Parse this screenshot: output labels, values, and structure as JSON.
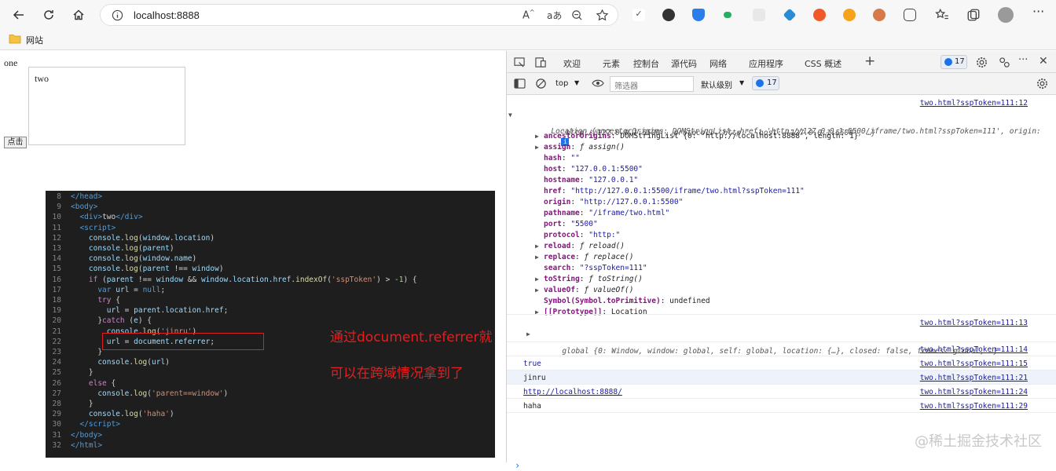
{
  "browser": {
    "url": "localhost:8888",
    "bookmark_label": "网站"
  },
  "page": {
    "outer_text": "one",
    "iframe_text": "two",
    "button_label": "点击"
  },
  "code_lines": [
    {
      "n": "8",
      "html": "<span class=\"t\">&lt;/head&gt;</span>"
    },
    {
      "n": "9",
      "html": "<span class=\"t\">&lt;body&gt;</span>"
    },
    {
      "n": "10",
      "html": "  <span class=\"t\">&lt;div&gt;</span>two<span class=\"t\">&lt;/div&gt;</span>"
    },
    {
      "n": "11",
      "html": "  <span class=\"t\">&lt;script&gt;</span>"
    },
    {
      "n": "12",
      "html": "    <span class=\"v\">console</span>.<span class=\"f\">log</span>(<span class=\"v\">window</span>.<span class=\"v\">location</span>)"
    },
    {
      "n": "13",
      "html": "    <span class=\"v\">console</span>.<span class=\"f\">log</span>(<span class=\"v\">parent</span>)"
    },
    {
      "n": "14",
      "html": "    <span class=\"v\">console</span>.<span class=\"f\">log</span>(<span class=\"v\">window</span>.<span class=\"v\">name</span>)"
    },
    {
      "n": "15",
      "html": "    <span class=\"v\">console</span>.<span class=\"f\">log</span>(<span class=\"v\">parent</span> !== <span class=\"v\">window</span>)"
    },
    {
      "n": "16",
      "html": "    <span class=\"k\">if</span> (<span class=\"v\">parent</span> !== <span class=\"v\">window</span> &amp;&amp; <span class=\"v\">window</span>.<span class=\"v\">location</span>.<span class=\"v\">href</span>.<span class=\"f\">indexOf</span>(<span class=\"s\">'sspToken'</span>) &gt; <span class=\"n\">-1</span>) {"
    },
    {
      "n": "17",
      "html": "      <span class=\"t\">var</span> <span class=\"v\">url</span> = <span class=\"t\">null</span>;"
    },
    {
      "n": "18",
      "html": "      <span class=\"k\">try</span> {"
    },
    {
      "n": "19",
      "html": "        <span class=\"v\">url</span> = <span class=\"v\">parent</span>.<span class=\"v\">location</span>.<span class=\"v\">href</span>;"
    },
    {
      "n": "20",
      "html": "      }<span class=\"k\">catch</span> (<span class=\"v\">e</span>) {"
    },
    {
      "n": "21",
      "html": "        <span class=\"v\">console</span>.<span class=\"f\">log</span>(<span class=\"s\">'jinru'</span>)"
    },
    {
      "n": "22",
      "html": "        <span class=\"v\">url</span> = <span class=\"v\">document</span>.<span class=\"v\">referrer</span>;"
    },
    {
      "n": "23",
      "html": "      }"
    },
    {
      "n": "24",
      "html": "      <span class=\"v\">console</span>.<span class=\"f\">log</span>(<span class=\"v\">url</span>)"
    },
    {
      "n": "25",
      "html": "    }"
    },
    {
      "n": "26",
      "html": "    <span class=\"k\">else</span> {"
    },
    {
      "n": "27",
      "html": "      <span class=\"v\">console</span>.<span class=\"f\">log</span>(<span class=\"s\">'parent==window'</span>)"
    },
    {
      "n": "28",
      "html": "    }"
    },
    {
      "n": "29",
      "html": "    <span class=\"v\">console</span>.<span class=\"f\">log</span>(<span class=\"s\">'haha'</span>)"
    },
    {
      "n": "30",
      "html": "  <span class=\"t\">&lt;/script&gt;</span>"
    },
    {
      "n": "31",
      "html": "<span class=\"t\">&lt;/body&gt;</span>"
    },
    {
      "n": "32",
      "html": "<span class=\"t\">&lt;/html&gt;</span>"
    }
  ],
  "annotation": {
    "line1": "通过document.referrer就",
    "line2": "可以在跨域情况拿到了"
  },
  "devtools": {
    "tabs": [
      "欢迎",
      "元素",
      "控制台",
      "源代码",
      "网络",
      "应用程序",
      "CSS 概述"
    ],
    "active_tab": "控制台",
    "issues_count": "17",
    "context": "top",
    "filter_placeholder": "筛选器",
    "level": "默认级别",
    "level_count": "17"
  },
  "console": {
    "location_src": "two.html?sspToken=111:12",
    "location_summary_1": "Location {ancestorOrigins: DOMStringList, href: 'http://127.0.0.1:5500/iframe/two.html?sspToken=111', origin:",
    "location_summary_2": "'http://127.0.0.1:5500', protocol: 'http:', host: '127.0.0.1:5500', …}",
    "props": [
      {
        "key": "ancestorOrigins",
        "val": "DOMStringList {0: 'http://localhost:8888', length: 1}",
        "expand": true,
        "kind": "obj"
      },
      {
        "key": "assign",
        "val": "ƒ assign()",
        "expand": true,
        "kind": "fn"
      },
      {
        "key": "hash",
        "val": "\"\"",
        "expand": false,
        "kind": "str"
      },
      {
        "key": "host",
        "val": "\"127.0.0.1:5500\"",
        "expand": false,
        "kind": "str"
      },
      {
        "key": "hostname",
        "val": "\"127.0.0.1\"",
        "expand": false,
        "kind": "str"
      },
      {
        "key": "href",
        "val": "\"http://127.0.0.1:5500/iframe/two.html?sspToken=111\"",
        "expand": false,
        "kind": "str"
      },
      {
        "key": "origin",
        "val": "\"http://127.0.0.1:5500\"",
        "expand": false,
        "kind": "str"
      },
      {
        "key": "pathname",
        "val": "\"/iframe/two.html\"",
        "expand": false,
        "kind": "str"
      },
      {
        "key": "port",
        "val": "\"5500\"",
        "expand": false,
        "kind": "str"
      },
      {
        "key": "protocol",
        "val": "\"http:\"",
        "expand": false,
        "kind": "str"
      },
      {
        "key": "reload",
        "val": "ƒ reload()",
        "expand": true,
        "kind": "fn"
      },
      {
        "key": "replace",
        "val": "ƒ replace()",
        "expand": true,
        "kind": "fn"
      },
      {
        "key": "search",
        "val": "\"?sspToken=111\"",
        "expand": false,
        "kind": "str"
      },
      {
        "key": "toString",
        "val": "ƒ toString()",
        "expand": true,
        "kind": "fn"
      },
      {
        "key": "valueOf",
        "val": "ƒ valueOf()",
        "expand": true,
        "kind": "fn"
      },
      {
        "key": "Symbol(Symbol.toPrimitive)",
        "val": "undefined",
        "expand": false,
        "kind": "plain"
      },
      {
        "key": "[[Prototype]]",
        "val": "Location",
        "expand": true,
        "kind": "plain"
      }
    ],
    "global_src": "two.html?sspToken=111:13",
    "global_summary": "global {0: Window, window: global, self: global, location: {…}, closed: false, frames: global, …}",
    "lines": [
      {
        "text": "",
        "src": "two.html?sspToken=111:14"
      },
      {
        "text": "true",
        "src": "two.html?sspToken=111:15"
      },
      {
        "text": "jinru",
        "src": "two.html?sspToken=111:21"
      },
      {
        "text": "http://localhost:8888/",
        "src": "two.html?sspToken=111:24"
      },
      {
        "text": "haha",
        "src": "two.html?sspToken=111:29"
      }
    ],
    "prompt": "›"
  },
  "watermark": "@稀土掘金技术社区"
}
